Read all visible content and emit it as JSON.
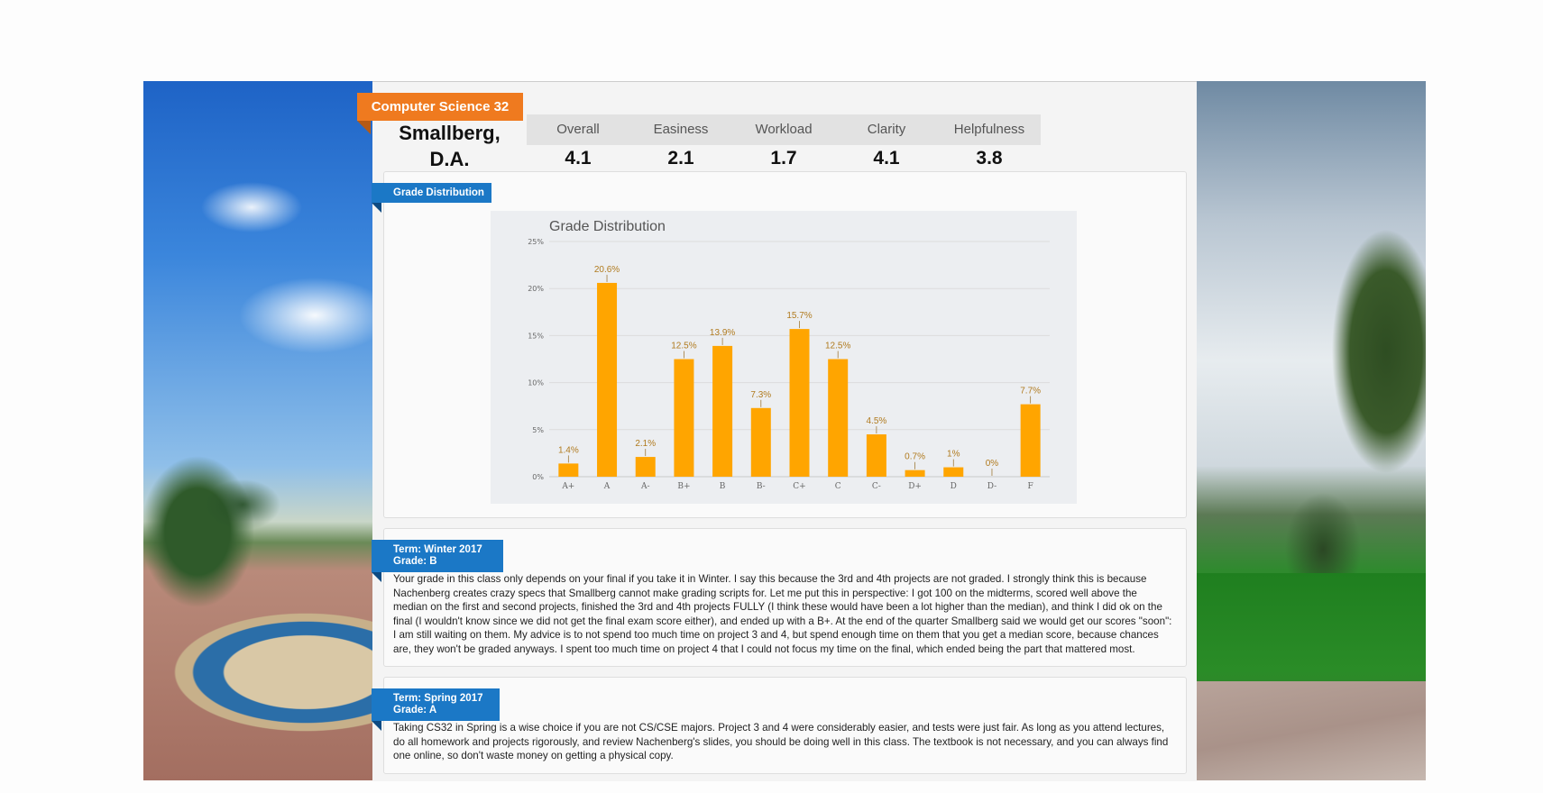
{
  "course": {
    "title": "Computer Science 32"
  },
  "professor": {
    "name_line1": "Smallberg,",
    "name_line2": "D.A."
  },
  "ratings": [
    {
      "label": "Overall",
      "value": "4.1"
    },
    {
      "label": "Easiness",
      "value": "2.1"
    },
    {
      "label": "Workload",
      "value": "1.7"
    },
    {
      "label": "Clarity",
      "value": "4.1"
    },
    {
      "label": "Helpfulness",
      "value": "3.8"
    }
  ],
  "grade_section": {
    "tag": "Grade Distribution"
  },
  "chart_data": {
    "type": "bar",
    "title": "Grade Distribution",
    "categories": [
      "A+",
      "A",
      "A-",
      "B+",
      "B",
      "B-",
      "C+",
      "C",
      "C-",
      "D+",
      "D",
      "D-",
      "F"
    ],
    "values": [
      1.4,
      20.6,
      2.1,
      12.5,
      13.9,
      7.3,
      15.7,
      12.5,
      4.5,
      0.7,
      1,
      0,
      7.7
    ],
    "value_labels": [
      "1.4%",
      "20.6%",
      "2.1%",
      "12.5%",
      "13.9%",
      "7.3%",
      "15.7%",
      "12.5%",
      "4.5%",
      "0.7%",
      "1%",
      "0%",
      "7.7%"
    ],
    "y_ticks": [
      "0%",
      "5%",
      "10%",
      "15%",
      "20%",
      "25%"
    ],
    "ylim": [
      0,
      25
    ],
    "bar_color": "#ffa500",
    "grid": true,
    "xlabel": "",
    "ylabel": ""
  },
  "reviews": [
    {
      "term": "Term: Winter 2017",
      "grade": "Grade: B",
      "text": "Your grade in this class only depends on your final if you take it in Winter. I say this because the 3rd and 4th projects are not graded. I strongly think this is because Nachenberg creates crazy specs that Smallberg cannot make grading scripts for. Let me put this in perspective: I got 100 on the midterms, scored well above the median on the first and second projects, finished the 3rd and 4th projects FULLY (I think these would have been a lot higher than the median), and think I did ok on the final (I wouldn't know since we did not get the final exam score either), and ended up with a B+. At the end of the quarter Smallberg said we would get our scores \"soon\": I am still waiting on them. My advice is to not spend too much time on project 3 and 4, but spend enough time on them that you get a median score, because chances are, they won't be graded anyways. I spent too much time on project 4 that I could not focus my time on the final, which ended being the part that mattered most."
    },
    {
      "term": "Term: Spring 2017",
      "grade": "Grade: A",
      "text": "Taking CS32 in Spring is a wise choice if you are not CS/CSE majors. Project 3 and 4 were considerably easier, and tests were just fair. As long as you attend lectures, do all homework and projects rigorously, and review Nachenberg's slides, you should be doing well in this class. The textbook is not necessary, and you can always find one online, so don't waste money on getting a physical copy."
    }
  ]
}
